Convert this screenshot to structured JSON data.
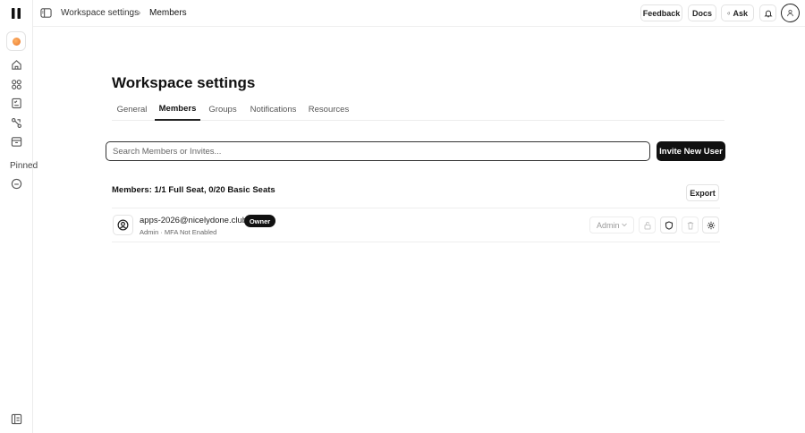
{
  "sidebar": {
    "pinned_label": "Pinned",
    "items": [
      {
        "icon": "home-icon"
      },
      {
        "icon": "grid-icon"
      },
      {
        "icon": "checklist-icon"
      },
      {
        "icon": "route-icon"
      },
      {
        "icon": "archive-icon"
      },
      {
        "icon": "pinned-circle-icon"
      },
      {
        "icon": "panel-icon"
      }
    ]
  },
  "breadcrumb": {
    "parent": "Workspace settings",
    "separator": "›",
    "current": "Members"
  },
  "topbar": {
    "feedback_label": "Feedback",
    "docs_label": "Docs",
    "ask_label": "Ask"
  },
  "page": {
    "title": "Workspace settings"
  },
  "tabs": [
    {
      "label": "General",
      "active": false
    },
    {
      "label": "Members",
      "active": true
    },
    {
      "label": "Groups",
      "active": false
    },
    {
      "label": "Notifications",
      "active": false
    },
    {
      "label": "Resources",
      "active": false
    }
  ],
  "search": {
    "placeholder": "Search Members or Invites..."
  },
  "invite_button_label": "Invite New User",
  "members_summary": "Members: 1/1 Full Seat, 0/20 Basic Seats",
  "export_label": "Export",
  "members": [
    {
      "email": "apps-2026@nicelydone.club",
      "badge": "Owner",
      "meta": "Admin · MFA Not Enabled",
      "role": "Admin"
    }
  ],
  "colors": {
    "accent": "#111111",
    "workspace_dot": "#e8752a",
    "border": "#e3e3e3"
  }
}
